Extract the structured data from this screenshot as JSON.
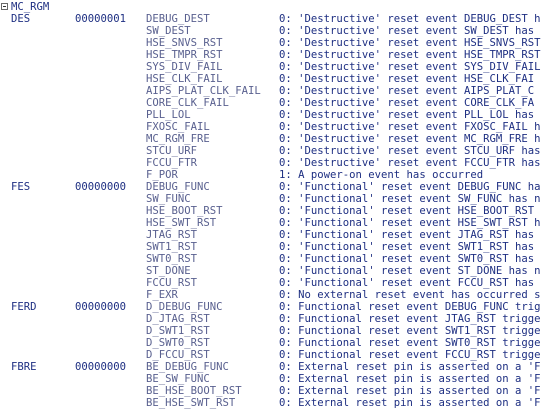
{
  "header": {
    "title": "MC_RGM"
  },
  "rows": [
    {
      "reg": "DES",
      "value": "00000001",
      "field": "DEBUG_DEST",
      "desc": "0: 'Destructive' reset event DEBUG_DEST h"
    },
    {
      "reg": "",
      "value": "",
      "field": "SW_DEST",
      "desc": "0: 'Destructive' reset event SW_DEST has"
    },
    {
      "reg": "",
      "value": "",
      "field": "HSE_SNVS_RST",
      "desc": "0: 'Destructive' reset event HSE_SNVS_RST"
    },
    {
      "reg": "",
      "value": "",
      "field": "HSE_TMPR_RST",
      "desc": "0: 'Destructive' reset event HSE_TMPR_RST"
    },
    {
      "reg": "",
      "value": "",
      "field": "SYS_DIV_FAIL",
      "desc": "0: 'Destructive' reset event SYS_DIV_FAIL"
    },
    {
      "reg": "",
      "value": "",
      "field": "HSE_CLK_FAIL",
      "desc": "0: 'Destructive' reset event HSE_CLK_FAI"
    },
    {
      "reg": "",
      "value": "",
      "field": "AIPS_PLAT_CLK_FAIL",
      "desc": "0: 'Destructive' reset event AIPS_PLAT_C"
    },
    {
      "reg": "",
      "value": "",
      "field": "CORE_CLK_FAIL",
      "desc": "0: 'Destructive' reset event CORE_CLK_FA"
    },
    {
      "reg": "",
      "value": "",
      "field": "PLL_LOL",
      "desc": "0: 'Destructive' reset event PLL_LOL has"
    },
    {
      "reg": "",
      "value": "",
      "field": "FXOSC_FAIL",
      "desc": "0: 'Destructive' reset event FXOSC_FAIL h"
    },
    {
      "reg": "",
      "value": "",
      "field": "MC_RGM_FRE",
      "desc": "0: 'Destructive' reset event MC_RGM_FRE h"
    },
    {
      "reg": "",
      "value": "",
      "field": "STCU_URF",
      "desc": "0: 'Destructive' reset event STCU_URF has"
    },
    {
      "reg": "",
      "value": "",
      "field": "FCCU_FTR",
      "desc": "0: 'Destructive' reset event FCCU_FTR has"
    },
    {
      "reg": "",
      "value": "",
      "field": "F_POR",
      "desc": "1: A power-on event has occurred"
    },
    {
      "reg": "FES",
      "value": "00000000",
      "field": "DEBUG_FUNC",
      "desc": "0: 'Functional' reset event DEBUG_FUNC ha"
    },
    {
      "reg": "",
      "value": "",
      "field": "SW_FUNC",
      "desc": "0: 'Functional' reset event SW_FUNC has n"
    },
    {
      "reg": "",
      "value": "",
      "field": "HSE_BOOT_RST",
      "desc": "0: 'Functional' reset event HSE_BOOT_RST"
    },
    {
      "reg": "",
      "value": "",
      "field": "HSE_SWT_RST",
      "desc": "0: 'Functional' reset event HSE_SWT_RST h"
    },
    {
      "reg": "",
      "value": "",
      "field": "JTAG_RST",
      "desc": "0: 'Functional' reset event JTAG_RST has"
    },
    {
      "reg": "",
      "value": "",
      "field": "SWT1_RST",
      "desc": "0: 'Functional' reset event SWT1_RST has"
    },
    {
      "reg": "",
      "value": "",
      "field": "SWT0_RST",
      "desc": "0: 'Functional' reset event SWT0_RST has"
    },
    {
      "reg": "",
      "value": "",
      "field": "ST_DONE",
      "desc": "0: 'Functional' reset event ST_DONE has n"
    },
    {
      "reg": "",
      "value": "",
      "field": "FCCU_RST",
      "desc": "0: 'Functional' reset event FCCU_RST has"
    },
    {
      "reg": "",
      "value": "",
      "field": "F_EXR",
      "desc": "0: No external reset event has occurred s"
    },
    {
      "reg": "FERD",
      "value": "00000000",
      "field": "D_DEBUG_FUNC",
      "desc": "0: Functional reset event DEBUG_FUNC trig"
    },
    {
      "reg": "",
      "value": "",
      "field": "D_JTAG_RST",
      "desc": "0: Functional reset event JTAG_RST trigge"
    },
    {
      "reg": "",
      "value": "",
      "field": "D_SWT1_RST",
      "desc": "0: Functional reset event SWT1_RST trigge"
    },
    {
      "reg": "",
      "value": "",
      "field": "D_SWT0_RST",
      "desc": "0: Functional reset event SWT0_RST trigge"
    },
    {
      "reg": "",
      "value": "",
      "field": "D_FCCU_RST",
      "desc": "0: Functional reset event FCCU_RST trigge"
    },
    {
      "reg": "FBRE",
      "value": "00000000",
      "field": "BE_DEBUG_FUNC",
      "desc": "0: External reset pin is asserted on a 'F"
    },
    {
      "reg": "",
      "value": "",
      "field": "BE_SW_FUNC",
      "desc": "0: External reset pin is asserted on a 'F"
    },
    {
      "reg": "",
      "value": "",
      "field": "BE_HSE_BOOT_RST",
      "desc": "0: External reset pin is asserted on a 'F"
    },
    {
      "reg": "",
      "value": "",
      "field": "BE_HSE_SWT_RST",
      "desc": "0: External reset pin is asserted on a 'F"
    }
  ]
}
